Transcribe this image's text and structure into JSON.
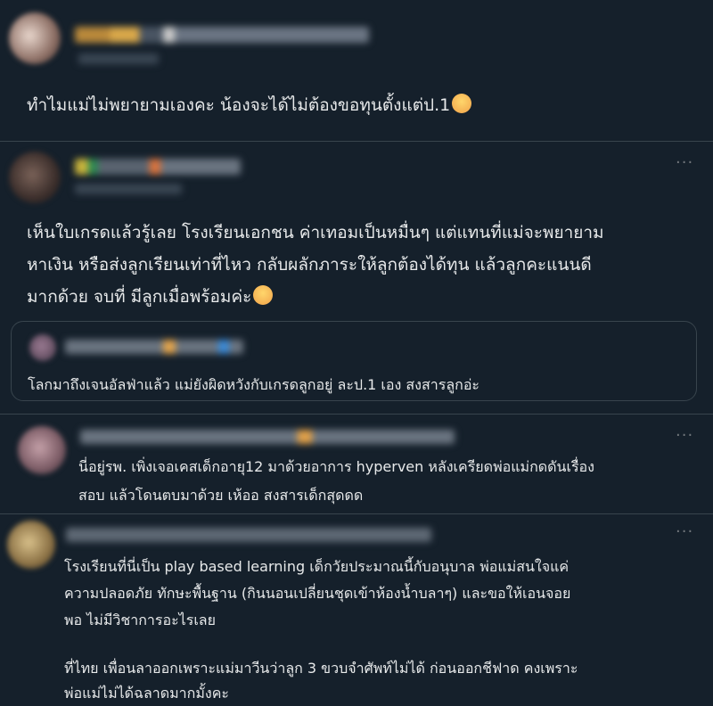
{
  "post1": {
    "text": "ทำไมแม่ไม่พยายามเองคะ น้องจะได้ไม่ต้องขอทุนตั้งแต่ป.1",
    "emoji": "hugging-face-emoji"
  },
  "post2": {
    "more": "···",
    "lines": [
      "เห็นใบเกรดแล้วรู้เลย โรงเรียนเอกชน ค่าเทอมเป็นหมื่นๆ แต่แทนที่แม่จะพยายาม",
      "หาเงิน หรือส่งลูกเรียนเท่าที่ไหว กลับผลักภาระให้ลูกต้องได้ทุน แล้วลูกคะแนนดี",
      "มากด้วย จบที่ มีลูกเมื่อพร้อมค่ะ"
    ],
    "emoji": "pensive-face-emoji",
    "quote": {
      "text": "โลกมาถึงเจนอัลฟ่าแล้ว แม่ยังผิดหวังกับเกรดลูกอยู่ ละป.1 เอง สงสารลูกอ่ะ"
    }
  },
  "post3": {
    "more": "···",
    "lines": [
      "นี่อยู่รพ. เพิ่งเจอเคสเด็กอายุ12 มาด้วยอาการ hyperven หลังเครียดพ่อแม่กดดันเรื่อง",
      "สอบ แล้วโดนตบมาด้วย เห้ออ สงสารเด็กสุดดด"
    ]
  },
  "post4": {
    "more": "···",
    "lines": [
      "โรงเรียนที่นี่เป็น play based learning เด็กวัยประมาณนี้กับอนุบาล พ่อแม่สนใจแค่",
      "ความปลอดภัย ทักษะพื้นฐาน (กินนอนเปลี่ยนชุดเข้าห้องน้ำบลาๆ) และขอให้เอนจอย",
      "พอ ไม่มีวิชาการอะไรเลย",
      "ที่ไทย เพื่อนลาออกเพราะแม่มาวีนว่าลูก 3 ขวบจำศัพท์ไม่ได้ ก่อนออกชีฟาด คงเพราะ",
      "พ่อแม่ไม่ได้ฉลาดมากมั้งคะ"
    ]
  },
  "colors": {
    "background": "#15202b",
    "text": "#e7e9ea",
    "muted": "#71767b",
    "border": "#38444d"
  }
}
